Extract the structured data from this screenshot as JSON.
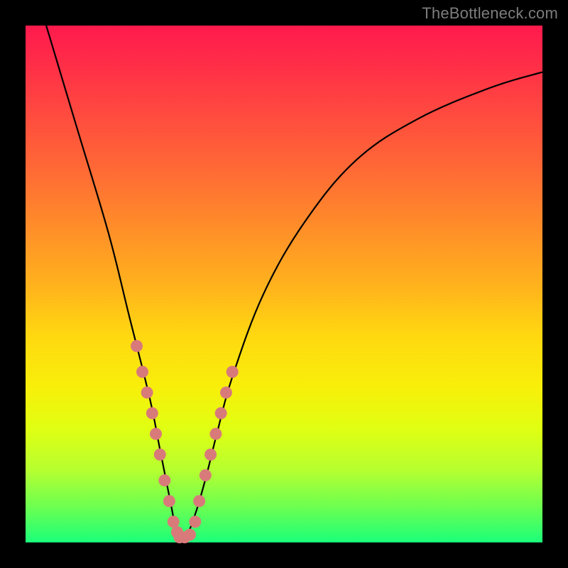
{
  "watermark": "TheBottleneck.com",
  "colors": {
    "frame_bg": "#000000",
    "marker_fill": "#d97a7a",
    "curve_stroke": "#000000"
  },
  "chart_data": {
    "type": "line",
    "title": "",
    "xlabel": "",
    "ylabel": "",
    "xlim": [
      0,
      100
    ],
    "ylim": [
      0,
      100
    ],
    "grid": false,
    "legend": false,
    "description": "Bottleneck-style V-curve over a vertical rainbow heat gradient. Y≈100 means high bottleneck (red, top), Y≈0 means balanced (green, bottom). Minimum of the curve sits near x≈30.",
    "series": [
      {
        "name": "bottleneck_curve",
        "x": [
          4,
          10,
          16,
          20,
          24,
          26,
          28,
          29.5,
          31,
          33,
          35,
          37,
          40,
          46,
          54,
          64,
          76,
          90,
          100
        ],
        "y": [
          100,
          80,
          60,
          44,
          28,
          18,
          8,
          1,
          1,
          6,
          13,
          21,
          32,
          48,
          62,
          74,
          82,
          88,
          91
        ]
      },
      {
        "name": "markers_left_branch",
        "type": "scatter",
        "x": [
          21.5,
          22.6,
          23.5,
          24.5,
          25.2,
          26.0,
          26.9,
          27.8,
          28.6,
          29.3
        ],
        "y": [
          38,
          33,
          29,
          25,
          21,
          17,
          12,
          8,
          4,
          2
        ]
      },
      {
        "name": "markers_bottom",
        "type": "scatter",
        "x": [
          29.8,
          30.8,
          31.8,
          32.8
        ],
        "y": [
          1,
          1,
          1.5,
          4
        ]
      },
      {
        "name": "markers_right_branch",
        "type": "scatter",
        "x": [
          33.6,
          34.8,
          35.8,
          36.8,
          37.8,
          38.8,
          40.0
        ],
        "y": [
          8,
          13,
          17,
          21,
          25,
          29,
          33
        ]
      }
    ]
  }
}
